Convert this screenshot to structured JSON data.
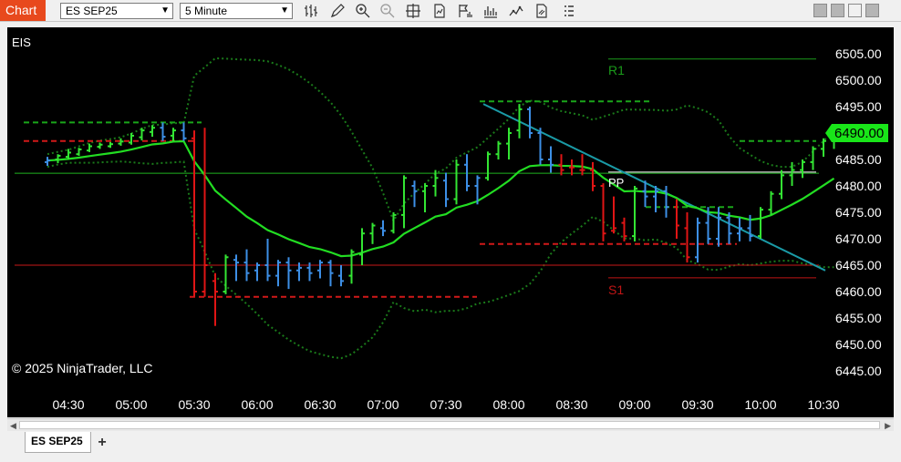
{
  "app": {
    "title": "Chart"
  },
  "toolbar": {
    "instrument": "ES SEP25",
    "interval": "5 Minute",
    "icons": [
      "bar-type-icon",
      "drawing-tool-icon",
      "zoom-in-icon",
      "zoom-out-icon",
      "crosshair-icon",
      "data-series-icon",
      "strategies-icon",
      "indicators-icon",
      "chart-trader-icon",
      "properties-icon",
      "menu-icon"
    ],
    "window_buttons": [
      "minimize-icon",
      "tile-icon",
      "maximize-icon",
      "close-icon"
    ]
  },
  "chart": {
    "instrument_label": "EIS",
    "copyright": "© 2025 NinjaTrader, LLC",
    "current_price": "6490.00",
    "price_labels": [
      "6505.00",
      "6500.00",
      "6495.00",
      "6490.00",
      "6485.00",
      "6480.00",
      "6475.00",
      "6470.00",
      "6465.00",
      "6460.00",
      "6455.00",
      "6450.00",
      "6445.00"
    ],
    "time_labels": [
      "04:30",
      "05:00",
      "05:30",
      "06:00",
      "06:30",
      "07:00",
      "07:30",
      "08:00",
      "08:30",
      "09:00",
      "09:30",
      "10:00",
      "10:30"
    ],
    "pivots": {
      "r1_label": "R1",
      "pp_label": "PP",
      "s1_label": "S1"
    },
    "colors": {
      "background": "#000000",
      "up_bar": "#33e533",
      "down_bar": "#e01515",
      "neutral_bar": "#3d8fe6",
      "ema": "#22dd22",
      "bollinger": "#1a7a1a",
      "trendline": "#1a9aa6",
      "price_marker": "#19e619",
      "r1": "#1a9a1a",
      "s1": "#c01515"
    }
  },
  "chart_data": {
    "type": "line",
    "yrange": [
      6445.0,
      6505.0
    ],
    "horizontal_lines": [
      {
        "name": "R1",
        "y": 6504.0
      },
      {
        "name": "PP",
        "y": 6482.6
      },
      {
        "name": "S1",
        "y": 6462.6
      }
    ],
    "ohlc_bars": [
      {
        "x": "04:20",
        "o": 6484.5,
        "h": 6485.5,
        "l": 6483.8,
        "c": 6484.8,
        "color": "neutral"
      },
      {
        "x": "04:25",
        "o": 6485.0,
        "h": 6486.0,
        "l": 6484.3,
        "c": 6485.7,
        "color": "up"
      },
      {
        "x": "04:30",
        "o": 6485.5,
        "h": 6487.0,
        "l": 6485.0,
        "c": 6486.3,
        "color": "up"
      },
      {
        "x": "04:35",
        "o": 6486.0,
        "h": 6487.2,
        "l": 6485.7,
        "c": 6486.9,
        "color": "up"
      },
      {
        "x": "04:40",
        "o": 6486.7,
        "h": 6488.0,
        "l": 6486.4,
        "c": 6487.5,
        "color": "up"
      },
      {
        "x": "04:45",
        "o": 6487.4,
        "h": 6488.2,
        "l": 6487.0,
        "c": 6487.8,
        "color": "up"
      },
      {
        "x": "04:50",
        "o": 6487.5,
        "h": 6488.3,
        "l": 6487.2,
        "c": 6487.9,
        "color": "up"
      },
      {
        "x": "04:55",
        "o": 6488.0,
        "h": 6489.0,
        "l": 6487.6,
        "c": 6488.4,
        "color": "up"
      },
      {
        "x": "05:00",
        "o": 6488.2,
        "h": 6490.0,
        "l": 6487.8,
        "c": 6489.5,
        "color": "up"
      },
      {
        "x": "05:05",
        "o": 6489.2,
        "h": 6491.0,
        "l": 6488.6,
        "c": 6490.5,
        "color": "up"
      },
      {
        "x": "05:10",
        "o": 6490.2,
        "h": 6491.5,
        "l": 6489.3,
        "c": 6491.0,
        "color": "up"
      },
      {
        "x": "05:15",
        "o": 6491.0,
        "h": 6492.0,
        "l": 6488.5,
        "c": 6489.3,
        "color": "neutral"
      },
      {
        "x": "05:20",
        "o": 6489.5,
        "h": 6491.0,
        "l": 6488.5,
        "c": 6490.5,
        "color": "up"
      },
      {
        "x": "05:25",
        "o": 6490.5,
        "h": 6492.0,
        "l": 6488.5,
        "c": 6489.0,
        "color": "neutral"
      },
      {
        "x": "05:30",
        "o": 6489.0,
        "h": 6490.5,
        "l": 6459.0,
        "c": 6460.0,
        "color": "down"
      },
      {
        "x": "05:35",
        "o": 6460.0,
        "h": 6491.0,
        "l": 6459.0,
        "c": 6465.0,
        "color": "down"
      },
      {
        "x": "05:40",
        "o": 6462.0,
        "h": 6463.5,
        "l": 6453.5,
        "c": 6460.0,
        "color": "down"
      },
      {
        "x": "05:45",
        "o": 6460.0,
        "h": 6467.0,
        "l": 6459.5,
        "c": 6466.5,
        "color": "up"
      },
      {
        "x": "05:50",
        "o": 6466.0,
        "h": 6467.0,
        "l": 6462.0,
        "c": 6465.5,
        "color": "neutral"
      },
      {
        "x": "05:55",
        "o": 6465.5,
        "h": 6468.0,
        "l": 6462.0,
        "c": 6463.5,
        "color": "neutral"
      },
      {
        "x": "06:00",
        "o": 6464.0,
        "h": 6465.5,
        "l": 6462.0,
        "c": 6465.0,
        "color": "neutral"
      },
      {
        "x": "06:05",
        "o": 6465.0,
        "h": 6470.0,
        "l": 6462.0,
        "c": 6463.0,
        "color": "neutral"
      },
      {
        "x": "06:10",
        "o": 6463.0,
        "h": 6466.0,
        "l": 6461.0,
        "c": 6465.5,
        "color": "neutral"
      },
      {
        "x": "06:15",
        "o": 6465.5,
        "h": 6466.5,
        "l": 6460.5,
        "c": 6464.0,
        "color": "neutral"
      },
      {
        "x": "06:20",
        "o": 6464.0,
        "h": 6465.5,
        "l": 6462.0,
        "c": 6464.5,
        "color": "neutral"
      },
      {
        "x": "06:25",
        "o": 6464.5,
        "h": 6465.5,
        "l": 6462.0,
        "c": 6463.5,
        "color": "neutral"
      },
      {
        "x": "06:30",
        "o": 6464.0,
        "h": 6466.0,
        "l": 6462.5,
        "c": 6465.5,
        "color": "neutral"
      },
      {
        "x": "06:35",
        "o": 6465.5,
        "h": 6466.0,
        "l": 6461.0,
        "c": 6463.5,
        "color": "neutral"
      },
      {
        "x": "06:40",
        "o": 6463.0,
        "h": 6465.0,
        "l": 6461.0,
        "c": 6462.0,
        "color": "neutral"
      },
      {
        "x": "06:45",
        "o": 6463.0,
        "h": 6468.0,
        "l": 6461.5,
        "c": 6467.5,
        "color": "up"
      },
      {
        "x": "06:50",
        "o": 6467.0,
        "h": 6472.0,
        "l": 6465.0,
        "c": 6471.0,
        "color": "up"
      },
      {
        "x": "06:55",
        "o": 6471.0,
        "h": 6473.0,
        "l": 6469.0,
        "c": 6472.5,
        "color": "up"
      },
      {
        "x": "07:00",
        "o": 6472.0,
        "h": 6473.5,
        "l": 6470.5,
        "c": 6471.5,
        "color": "neutral"
      },
      {
        "x": "07:05",
        "o": 6471.5,
        "h": 6475.0,
        "l": 6471.0,
        "c": 6474.5,
        "color": "up"
      },
      {
        "x": "07:10",
        "o": 6474.5,
        "h": 6482.0,
        "l": 6472.0,
        "c": 6481.5,
        "color": "up"
      },
      {
        "x": "07:15",
        "o": 6480.0,
        "h": 6481.0,
        "l": 6476.0,
        "c": 6479.0,
        "color": "neutral"
      },
      {
        "x": "07:20",
        "o": 6479.0,
        "h": 6480.5,
        "l": 6475.0,
        "c": 6480.0,
        "color": "up"
      },
      {
        "x": "07:25",
        "o": 6480.0,
        "h": 6483.0,
        "l": 6478.0,
        "c": 6481.5,
        "color": "up"
      },
      {
        "x": "07:30",
        "o": 6481.0,
        "h": 6482.5,
        "l": 6476.0,
        "c": 6477.5,
        "color": "neutral"
      },
      {
        "x": "07:35",
        "o": 6477.5,
        "h": 6485.0,
        "l": 6476.5,
        "c": 6484.0,
        "color": "up"
      },
      {
        "x": "07:40",
        "o": 6484.0,
        "h": 6486.0,
        "l": 6479.0,
        "c": 6480.0,
        "color": "neutral"
      },
      {
        "x": "07:45",
        "o": 6480.0,
        "h": 6482.0,
        "l": 6476.5,
        "c": 6481.5,
        "color": "neutral"
      },
      {
        "x": "07:50",
        "o": 6481.5,
        "h": 6486.5,
        "l": 6481.0,
        "c": 6486.0,
        "color": "up"
      },
      {
        "x": "07:55",
        "o": 6486.0,
        "h": 6488.5,
        "l": 6485.0,
        "c": 6488.0,
        "color": "up"
      },
      {
        "x": "08:00",
        "o": 6488.0,
        "h": 6491.0,
        "l": 6485.0,
        "c": 6490.0,
        "color": "up"
      },
      {
        "x": "08:05",
        "o": 6490.5,
        "h": 6495.5,
        "l": 6489.0,
        "c": 6494.5,
        "color": "up"
      },
      {
        "x": "08:10",
        "o": 6494.5,
        "h": 6495.0,
        "l": 6489.0,
        "c": 6490.0,
        "color": "neutral"
      },
      {
        "x": "08:15",
        "o": 6490.0,
        "h": 6491.0,
        "l": 6484.0,
        "c": 6485.0,
        "color": "neutral"
      },
      {
        "x": "08:20",
        "o": 6485.0,
        "h": 6487.5,
        "l": 6482.5,
        "c": 6484.0,
        "color": "neutral"
      },
      {
        "x": "08:25",
        "o": 6484.0,
        "h": 6486.0,
        "l": 6482.0,
        "c": 6483.0,
        "color": "down"
      },
      {
        "x": "08:30",
        "o": 6483.5,
        "h": 6485.0,
        "l": 6482.0,
        "c": 6483.5,
        "color": "down"
      },
      {
        "x": "08:35",
        "o": 6483.0,
        "h": 6486.0,
        "l": 6482.0,
        "c": 6483.0,
        "color": "down"
      },
      {
        "x": "08:40",
        "o": 6483.0,
        "h": 6484.5,
        "l": 6479.0,
        "c": 6480.0,
        "color": "down"
      },
      {
        "x": "08:45",
        "o": 6480.0,
        "h": 6480.5,
        "l": 6469.5,
        "c": 6471.0,
        "color": "down"
      },
      {
        "x": "08:50",
        "o": 6471.5,
        "h": 6478.0,
        "l": 6471.0,
        "c": 6472.0,
        "color": "down"
      },
      {
        "x": "08:55",
        "o": 6473.0,
        "h": 6474.0,
        "l": 6469.5,
        "c": 6470.5,
        "color": "down"
      },
      {
        "x": "09:00",
        "o": 6470.5,
        "h": 6480.0,
        "l": 6469.5,
        "c": 6479.5,
        "color": "up"
      },
      {
        "x": "09:05",
        "o": 6479.0,
        "h": 6481.0,
        "l": 6476.0,
        "c": 6478.0,
        "color": "neutral"
      },
      {
        "x": "09:10",
        "o": 6478.0,
        "h": 6480.0,
        "l": 6475.0,
        "c": 6479.0,
        "color": "neutral"
      },
      {
        "x": "09:15",
        "o": 6479.0,
        "h": 6480.0,
        "l": 6474.0,
        "c": 6476.0,
        "color": "neutral"
      },
      {
        "x": "09:20",
        "o": 6476.0,
        "h": 6477.5,
        "l": 6470.0,
        "c": 6472.5,
        "color": "down"
      },
      {
        "x": "09:25",
        "o": 6472.0,
        "h": 6475.0,
        "l": 6465.5,
        "c": 6466.5,
        "color": "down"
      },
      {
        "x": "09:30",
        "o": 6466.5,
        "h": 6474.0,
        "l": 6465.5,
        "c": 6473.0,
        "color": "neutral"
      },
      {
        "x": "09:35",
        "o": 6473.0,
        "h": 6476.0,
        "l": 6469.0,
        "c": 6470.0,
        "color": "neutral"
      },
      {
        "x": "09:40",
        "o": 6470.0,
        "h": 6476.0,
        "l": 6468.5,
        "c": 6474.0,
        "color": "neutral"
      },
      {
        "x": "09:45",
        "o": 6474.0,
        "h": 6475.0,
        "l": 6469.0,
        "c": 6471.0,
        "color": "neutral"
      },
      {
        "x": "09:50",
        "o": 6471.0,
        "h": 6474.0,
        "l": 6469.5,
        "c": 6472.0,
        "color": "neutral"
      },
      {
        "x": "09:55",
        "o": 6472.0,
        "h": 6474.5,
        "l": 6469.5,
        "c": 6470.5,
        "color": "neutral"
      },
      {
        "x": "10:00",
        "o": 6470.5,
        "h": 6476.0,
        "l": 6470.0,
        "c": 6475.5,
        "color": "up"
      },
      {
        "x": "10:05",
        "o": 6475.5,
        "h": 6479.0,
        "l": 6474.5,
        "c": 6478.5,
        "color": "up"
      },
      {
        "x": "10:10",
        "o": 6478.5,
        "h": 6483.0,
        "l": 6477.5,
        "c": 6482.0,
        "color": "up"
      },
      {
        "x": "10:15",
        "o": 6482.0,
        "h": 6484.5,
        "l": 6480.0,
        "c": 6483.0,
        "color": "up"
      },
      {
        "x": "10:20",
        "o": 6483.0,
        "h": 6485.0,
        "l": 6481.5,
        "c": 6484.5,
        "color": "up"
      },
      {
        "x": "10:25",
        "o": 6484.5,
        "h": 6487.5,
        "l": 6483.0,
        "c": 6487.0,
        "color": "up"
      },
      {
        "x": "10:30",
        "o": 6487.0,
        "h": 6489.0,
        "l": 6485.5,
        "c": 6488.5,
        "color": "up"
      },
      {
        "x": "10:35",
        "o": 6488.5,
        "h": 6490.5,
        "l": 6487.0,
        "c": 6490.0,
        "color": "up"
      }
    ]
  }
}
